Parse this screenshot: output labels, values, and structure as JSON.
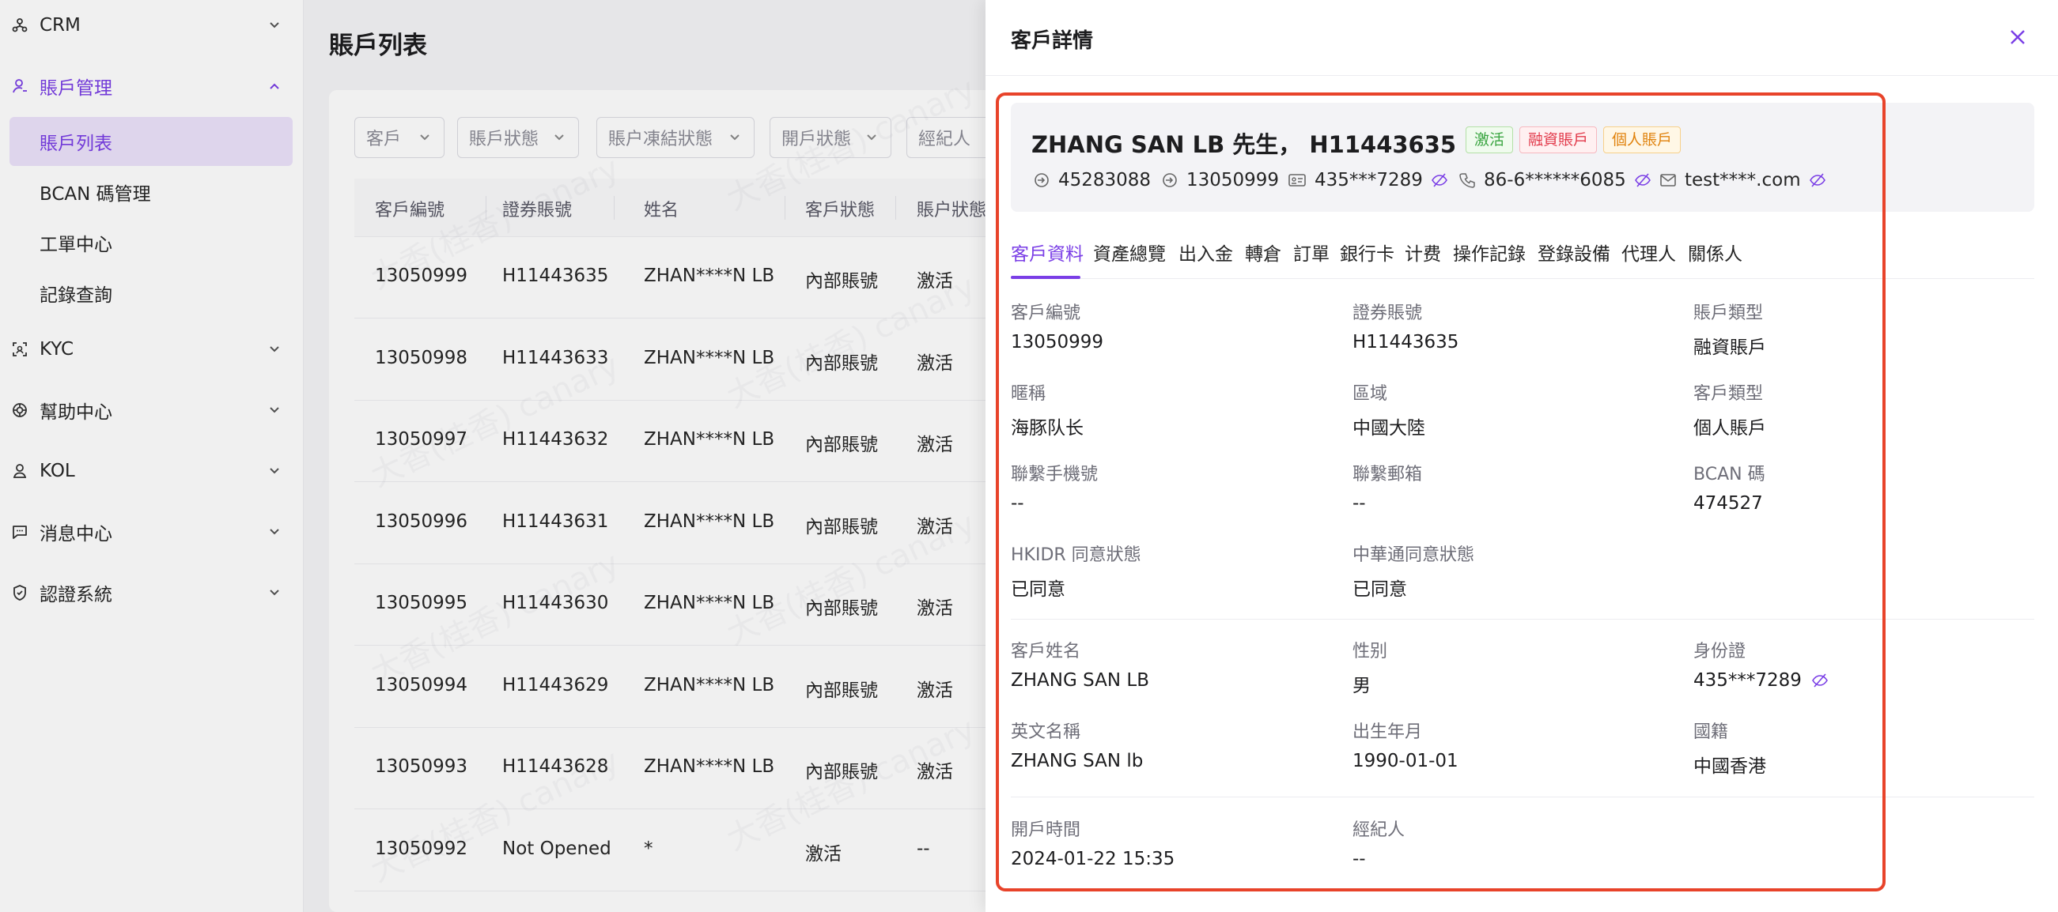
{
  "sidebar": {
    "items": [
      {
        "label": "CRM",
        "icon": "network-icon"
      },
      {
        "label": "賬戶管理",
        "icon": "user-icon"
      },
      {
        "label": "KYC",
        "icon": "scan-icon"
      },
      {
        "label": "幫助中心",
        "icon": "lifebuoy-icon"
      },
      {
        "label": "KOL",
        "icon": "person-icon"
      },
      {
        "label": "消息中心",
        "icon": "message-icon"
      },
      {
        "label": "認證系統",
        "icon": "shield-icon"
      }
    ],
    "sub_items": [
      "賬戶列表",
      "BCAN 碼管理",
      "工單中心",
      "記錄查詢"
    ]
  },
  "main": {
    "title": "賬戶列表",
    "filters": [
      "客戶",
      "賬戶狀態",
      "賬户凍結狀態",
      "開戶狀態",
      "經紀人"
    ],
    "columns": [
      "客戶編號",
      "證券賬號",
      "姓名",
      "客戶狀態",
      "賬户狀態"
    ],
    "rows": [
      [
        "13050999",
        "H11443635",
        "ZHAN****N LB",
        "內部賬號",
        "激活"
      ],
      [
        "13050998",
        "H11443633",
        "ZHAN****N LB",
        "內部賬號",
        "激活"
      ],
      [
        "13050997",
        "H11443632",
        "ZHAN****N LB",
        "內部賬號",
        "激活"
      ],
      [
        "13050996",
        "H11443631",
        "ZHAN****N LB",
        "內部賬號",
        "激活"
      ],
      [
        "13050995",
        "H11443630",
        "ZHAN****N LB",
        "內部賬號",
        "激活"
      ],
      [
        "13050994",
        "H11443629",
        "ZHAN****N LB",
        "內部賬號",
        "激活"
      ],
      [
        "13050993",
        "H11443628",
        "ZHAN****N LB",
        "內部賬號",
        "激活"
      ],
      [
        "13050992",
        "Not Opened",
        "*",
        "激活",
        "--"
      ]
    ],
    "watermark": "大香(桂香) canary"
  },
  "drawer": {
    "title": "客戶詳情",
    "customer_name": "ZHANG SAN LB 先生， H11443635",
    "tags": [
      "激活",
      "融資賬戶",
      "個人賬戶"
    ],
    "info": {
      "id_a": "45283088",
      "id_b": "13050999",
      "id_card": "435***7289",
      "phone": "86-6******6085",
      "email": "test****.com"
    },
    "tabs": [
      "客戶資料",
      "資產總覽",
      "出入金",
      "轉倉",
      "訂單",
      "銀行卡",
      "计费",
      "操作記錄",
      "登錄設備",
      "代理人",
      "關係人"
    ],
    "fields": [
      {
        "label": "客戶編號",
        "value": "13050999"
      },
      {
        "label": "證券賬號",
        "value": "H11443635"
      },
      {
        "label": "賬戶類型",
        "value": "融資賬戶"
      },
      {
        "label": "暱稱",
        "value": "海豚队长"
      },
      {
        "label": "區域",
        "value": "中國大陸"
      },
      {
        "label": "客戶類型",
        "value": "個人賬戶"
      },
      {
        "label": "聯繫手機號",
        "value": "--"
      },
      {
        "label": "聯繫郵箱",
        "value": "--"
      },
      {
        "label": "BCAN 碼",
        "value": "474527"
      },
      {
        "label": "HKIDR 同意狀態",
        "value": "已同意"
      },
      {
        "label": "中華通同意狀態",
        "value": "已同意"
      },
      {
        "label": "客戶姓名",
        "value": "ZHANG SAN LB"
      },
      {
        "label": "性别",
        "value": "男"
      },
      {
        "label": "身份證",
        "value": "435***7289"
      },
      {
        "label": "英文名稱",
        "value": "ZHANG SAN lb"
      },
      {
        "label": "出生年月",
        "value": "1990-01-01"
      },
      {
        "label": "國籍",
        "value": "中國香港"
      },
      {
        "label": "開戶時間",
        "value": "2024-01-22 15:35"
      },
      {
        "label": "經紀人",
        "value": "--"
      }
    ]
  },
  "colors": {
    "accent": "#7a3ee6",
    "highlight": "#e8432a"
  }
}
